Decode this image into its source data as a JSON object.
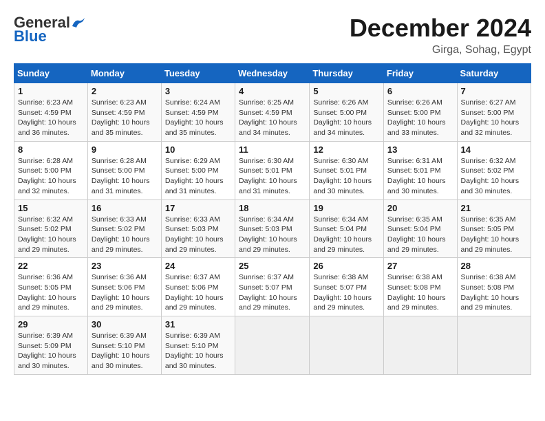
{
  "header": {
    "logo_general": "General",
    "logo_blue": "Blue",
    "month_title": "December 2024",
    "location": "Girga, Sohag, Egypt"
  },
  "days_of_week": [
    "Sunday",
    "Monday",
    "Tuesday",
    "Wednesday",
    "Thursday",
    "Friday",
    "Saturday"
  ],
  "weeks": [
    [
      {
        "day": "1",
        "sunrise": "6:23 AM",
        "sunset": "4:59 PM",
        "daylight": "10 hours and 36 minutes."
      },
      {
        "day": "2",
        "sunrise": "6:23 AM",
        "sunset": "4:59 PM",
        "daylight": "10 hours and 35 minutes."
      },
      {
        "day": "3",
        "sunrise": "6:24 AM",
        "sunset": "4:59 PM",
        "daylight": "10 hours and 35 minutes."
      },
      {
        "day": "4",
        "sunrise": "6:25 AM",
        "sunset": "4:59 PM",
        "daylight": "10 hours and 34 minutes."
      },
      {
        "day": "5",
        "sunrise": "6:26 AM",
        "sunset": "5:00 PM",
        "daylight": "10 hours and 34 minutes."
      },
      {
        "day": "6",
        "sunrise": "6:26 AM",
        "sunset": "5:00 PM",
        "daylight": "10 hours and 33 minutes."
      },
      {
        "day": "7",
        "sunrise": "6:27 AM",
        "sunset": "5:00 PM",
        "daylight": "10 hours and 32 minutes."
      }
    ],
    [
      {
        "day": "8",
        "sunrise": "6:28 AM",
        "sunset": "5:00 PM",
        "daylight": "10 hours and 32 minutes."
      },
      {
        "day": "9",
        "sunrise": "6:28 AM",
        "sunset": "5:00 PM",
        "daylight": "10 hours and 31 minutes."
      },
      {
        "day": "10",
        "sunrise": "6:29 AM",
        "sunset": "5:00 PM",
        "daylight": "10 hours and 31 minutes."
      },
      {
        "day": "11",
        "sunrise": "6:30 AM",
        "sunset": "5:01 PM",
        "daylight": "10 hours and 31 minutes."
      },
      {
        "day": "12",
        "sunrise": "6:30 AM",
        "sunset": "5:01 PM",
        "daylight": "10 hours and 30 minutes."
      },
      {
        "day": "13",
        "sunrise": "6:31 AM",
        "sunset": "5:01 PM",
        "daylight": "10 hours and 30 minutes."
      },
      {
        "day": "14",
        "sunrise": "6:32 AM",
        "sunset": "5:02 PM",
        "daylight": "10 hours and 30 minutes."
      }
    ],
    [
      {
        "day": "15",
        "sunrise": "6:32 AM",
        "sunset": "5:02 PM",
        "daylight": "10 hours and 29 minutes."
      },
      {
        "day": "16",
        "sunrise": "6:33 AM",
        "sunset": "5:02 PM",
        "daylight": "10 hours and 29 minutes."
      },
      {
        "day": "17",
        "sunrise": "6:33 AM",
        "sunset": "5:03 PM",
        "daylight": "10 hours and 29 minutes."
      },
      {
        "day": "18",
        "sunrise": "6:34 AM",
        "sunset": "5:03 PM",
        "daylight": "10 hours and 29 minutes."
      },
      {
        "day": "19",
        "sunrise": "6:34 AM",
        "sunset": "5:04 PM",
        "daylight": "10 hours and 29 minutes."
      },
      {
        "day": "20",
        "sunrise": "6:35 AM",
        "sunset": "5:04 PM",
        "daylight": "10 hours and 29 minutes."
      },
      {
        "day": "21",
        "sunrise": "6:35 AM",
        "sunset": "5:05 PM",
        "daylight": "10 hours and 29 minutes."
      }
    ],
    [
      {
        "day": "22",
        "sunrise": "6:36 AM",
        "sunset": "5:05 PM",
        "daylight": "10 hours and 29 minutes."
      },
      {
        "day": "23",
        "sunrise": "6:36 AM",
        "sunset": "5:06 PM",
        "daylight": "10 hours and 29 minutes."
      },
      {
        "day": "24",
        "sunrise": "6:37 AM",
        "sunset": "5:06 PM",
        "daylight": "10 hours and 29 minutes."
      },
      {
        "day": "25",
        "sunrise": "6:37 AM",
        "sunset": "5:07 PM",
        "daylight": "10 hours and 29 minutes."
      },
      {
        "day": "26",
        "sunrise": "6:38 AM",
        "sunset": "5:07 PM",
        "daylight": "10 hours and 29 minutes."
      },
      {
        "day": "27",
        "sunrise": "6:38 AM",
        "sunset": "5:08 PM",
        "daylight": "10 hours and 29 minutes."
      },
      {
        "day": "28",
        "sunrise": "6:38 AM",
        "sunset": "5:08 PM",
        "daylight": "10 hours and 29 minutes."
      }
    ],
    [
      {
        "day": "29",
        "sunrise": "6:39 AM",
        "sunset": "5:09 PM",
        "daylight": "10 hours and 30 minutes."
      },
      {
        "day": "30",
        "sunrise": "6:39 AM",
        "sunset": "5:10 PM",
        "daylight": "10 hours and 30 minutes."
      },
      {
        "day": "31",
        "sunrise": "6:39 AM",
        "sunset": "5:10 PM",
        "daylight": "10 hours and 30 minutes."
      },
      null,
      null,
      null,
      null
    ]
  ]
}
